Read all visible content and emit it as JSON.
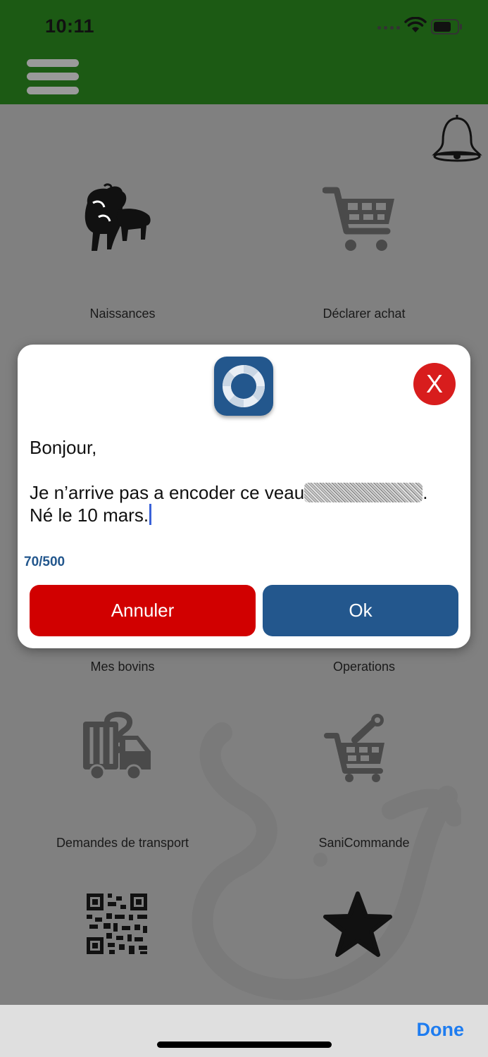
{
  "status_bar": {
    "time": "10:11"
  },
  "tiles": [
    {
      "label": "Naissances",
      "icon": "cows-icon"
    },
    {
      "label": "Déclarer achat",
      "icon": "cart-icon"
    },
    {
      "label": "Mes bovins",
      "icon": ""
    },
    {
      "label": "Operations",
      "icon": ""
    },
    {
      "label": "Demandes de transport",
      "icon": "truck-question-icon"
    },
    {
      "label": "SaniCommande",
      "icon": "cart-syringe-icon"
    },
    {
      "label": "",
      "icon": "qr-code-icon"
    },
    {
      "label": "",
      "icon": "star-icon"
    }
  ],
  "dialog": {
    "close_label": "X",
    "message_line1": "Bonjour,",
    "message_line2": "Je n’arrive pas a encoder ce veau",
    "message_line2_end": ".",
    "message_line3": "Né le 10 mars.",
    "counter": "70/500",
    "cancel_label": "Annuler",
    "ok_label": "Ok"
  },
  "keyboard_accessory": {
    "done_label": "Done"
  },
  "colors": {
    "header": "#1c5a14",
    "cancel": "#d10000",
    "ok": "#23578d",
    "close": "#d81d1d",
    "done": "#1e7cf0"
  }
}
